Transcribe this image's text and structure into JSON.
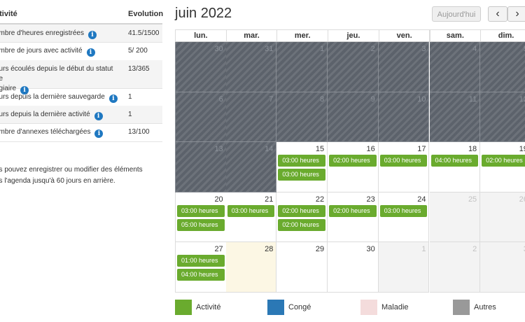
{
  "stats": {
    "header_activity": "ctivité",
    "header_evolution": "Evolution",
    "rows": [
      {
        "label": "ombre d'heures enregistrées",
        "value": "41.5/1500",
        "info": true
      },
      {
        "label": "ombre de jours avec activité",
        "value": "5/ 200",
        "info": true
      },
      {
        "label_line1": "ours écoulés depuis le début du statut de",
        "label_line2": "agiaire",
        "value": "13/365",
        "info": true
      },
      {
        "label": "ours depuis la dernière sauvegarde",
        "value": "1",
        "info": true
      },
      {
        "label": "ours depuis la dernière activité",
        "value": "1",
        "info": true
      },
      {
        "label": "ombre d'annexes téléchargées",
        "value": "13/100",
        "info": true
      }
    ],
    "note_line1": "us pouvez enregistrer ou modifier des éléments",
    "note_line2": "ns l'agenda jusqu'à 60 jours en arrière."
  },
  "calendar": {
    "title": "juin 2022",
    "today_label": "Aujourd'hui",
    "prev_icon": "chevron-left-icon",
    "next_icon": "chevron-right-icon",
    "weekdays": [
      "lun.",
      "mar.",
      "mer.",
      "jeu.",
      "ven.",
      "sam.",
      "dim."
    ],
    "weeks": [
      [
        "30",
        "31",
        "1",
        "2",
        "3",
        "4",
        "5"
      ],
      [
        "6",
        "7",
        "8",
        "9",
        "10",
        "11",
        "12"
      ],
      [
        "13",
        "14",
        "15",
        "16",
        "17",
        "18",
        "19"
      ],
      [
        "20",
        "21",
        "22",
        "23",
        "24",
        "25",
        "26"
      ],
      [
        "27",
        "28",
        "29",
        "30",
        "1",
        "2",
        "3"
      ]
    ],
    "events": {
      "15": [
        "03:00 heures",
        "03:00 heures"
      ],
      "16": [
        "02:00 heures"
      ],
      "17": [
        "03:00 heures"
      ],
      "18": [
        "04:00 heures"
      ],
      "19": [
        "02:00 heures"
      ],
      "20": [
        "03:00 heures",
        "05:00 heures"
      ],
      "21": [
        "03:00 heures"
      ],
      "22": [
        "02:00 heures",
        "02:00 heures"
      ],
      "23": [
        "02:00 heures"
      ],
      "24": [
        "03:00 heures"
      ],
      "27": [
        "01:00 heures",
        "04:00 heures"
      ]
    }
  },
  "legend": [
    {
      "label": "Activité",
      "color": "#6aab2e"
    },
    {
      "label": "Congé",
      "color": "#2b78b5"
    },
    {
      "label": "Maladie",
      "color": "#f4dcdc"
    },
    {
      "label": "Autres",
      "color": "#999999"
    }
  ],
  "colors": {
    "event": "#6aab2e",
    "info": "#1f78c1",
    "disabled_cell": "#5c626b",
    "today_cell": "#fcf7e4"
  }
}
